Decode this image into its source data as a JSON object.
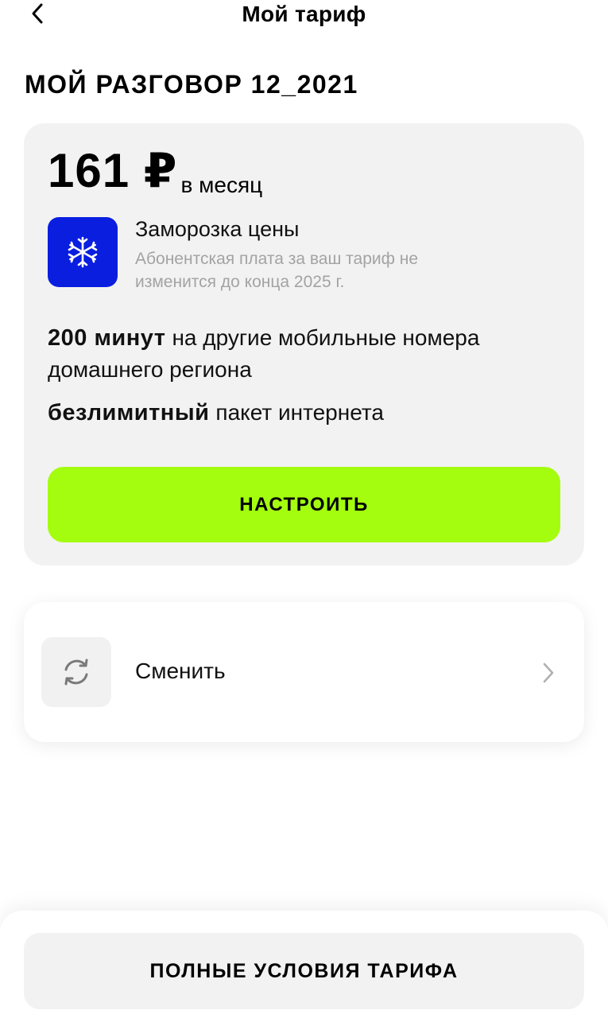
{
  "header": {
    "title": "Мой тариф",
    "back_icon": "chevron-left-icon"
  },
  "plan": {
    "name": "МОЙ РАЗГОВОР 12_2021"
  },
  "tariff_card": {
    "price": "161 ₽",
    "period": "в месяц",
    "freeze": {
      "icon": "snowflake-icon",
      "title": "Заморозка цены",
      "description": "Абонентская плата за ваш тариф не изменится до конца 2025 г."
    },
    "features": [
      {
        "strong": "200 минут",
        "text": "на другие мобильные номера домашнего региона"
      },
      {
        "strong": "безлимитный",
        "text": "пакет интернета"
      }
    ],
    "configure_label": "НАСТРОИТЬ"
  },
  "change_card": {
    "icon": "refresh-icon",
    "label": "Сменить",
    "chevron_icon": "chevron-right-icon"
  },
  "bottom": {
    "terms_label": "ПОЛНЫЕ УСЛОВИЯ ТАРИФА"
  },
  "colors": {
    "accent_green": "#a4fc0f",
    "freeze_blue": "#0a1ee0",
    "card_bg": "#f2f2f2",
    "muted_text": "#a3a3a3"
  }
}
